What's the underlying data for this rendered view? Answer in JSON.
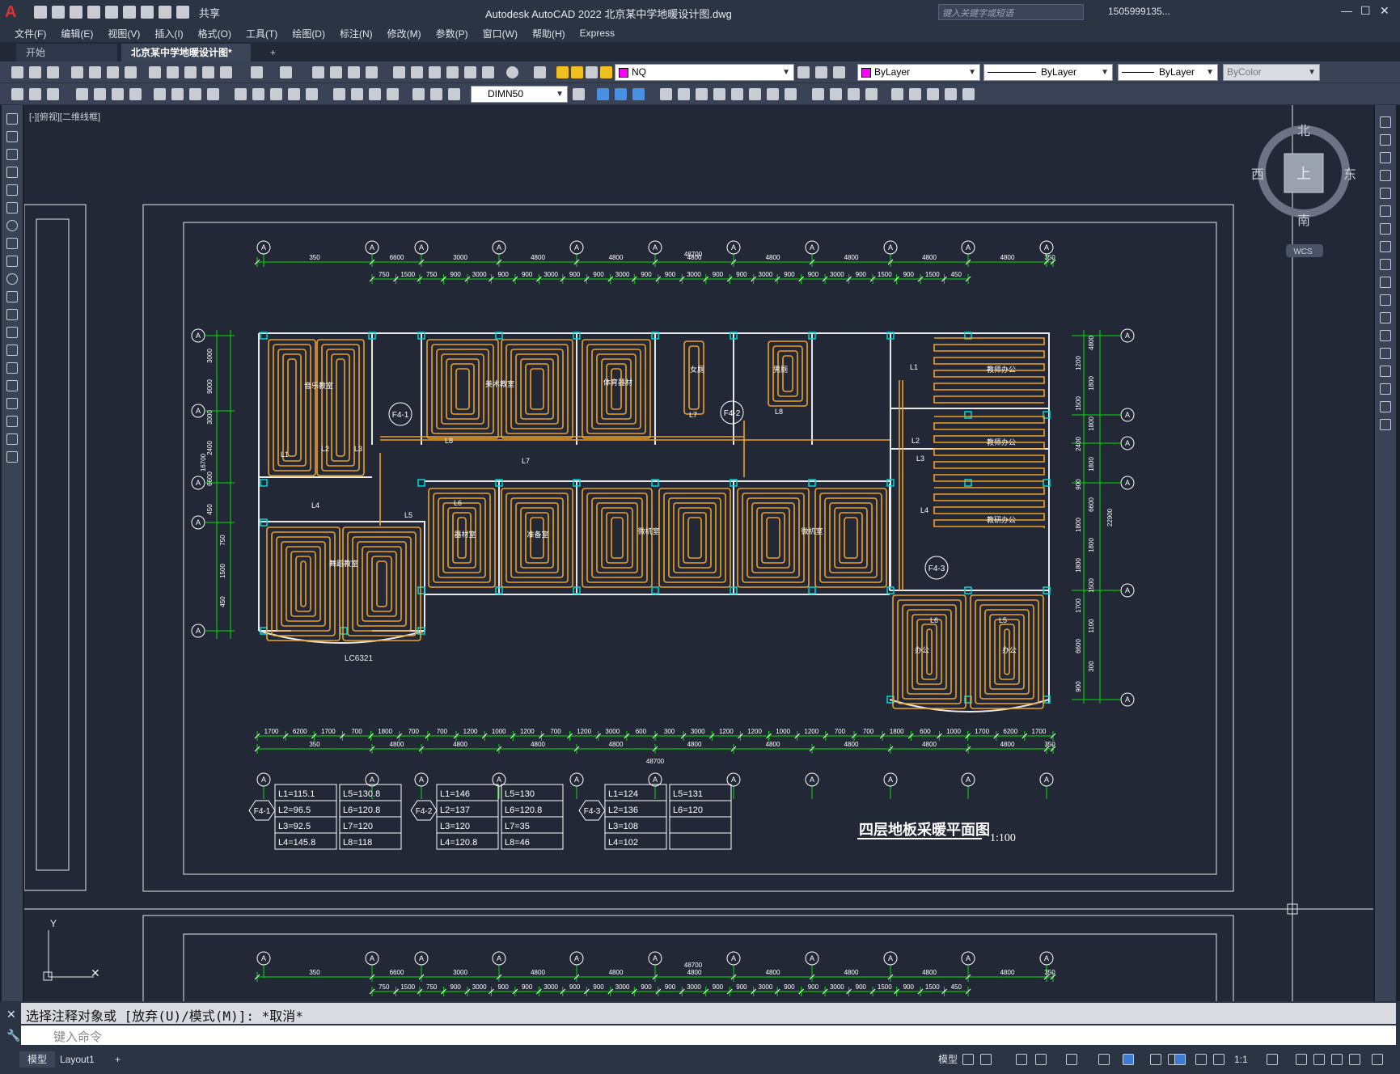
{
  "app": {
    "title": "Autodesk AutoCAD 2022    北京某中学地暖设计图.dwg",
    "share": "共享",
    "search_placeholder": "键入关键字或短语",
    "user": "1505999135...",
    "logo": "A"
  },
  "menu": [
    "文件(F)",
    "编辑(E)",
    "视图(V)",
    "插入(I)",
    "格式(O)",
    "工具(T)",
    "绘图(D)",
    "标注(N)",
    "修改(M)",
    "参数(P)",
    "窗口(W)",
    "帮助(H)",
    "Express"
  ],
  "tabs": {
    "start": "开始",
    "doc": "北京某中学地暖设计图*",
    "close": "×",
    "add": "+"
  },
  "toolbar": {
    "layer": "NQ",
    "color": "ByLayer",
    "linetype": "ByLayer",
    "lineweight": "ByLayer",
    "plotstyle": "ByColor",
    "dimstyle": "DIMN50"
  },
  "viewport": {
    "label": "[-][俯视][二维线框]",
    "north": "北",
    "south": "南",
    "east": "东",
    "west": "西",
    "top": "上",
    "wcs": "WCS"
  },
  "drawing": {
    "title": "四层地板采暖平面图",
    "scale": "1:100",
    "window_label": "LC6321",
    "top_total": "48700",
    "bottom_total": "48700",
    "left_total": "16700",
    "right_total": "22900",
    "top_dims": [
      "6600",
      "3000",
      "4800",
      "4800",
      "4800",
      "4800",
      "4800",
      "4800",
      "4800",
      "350",
      "350"
    ],
    "top_sub": [
      "750",
      "1500",
      "750",
      "900",
      "3000",
      "900",
      "900",
      "3000",
      "900",
      "900",
      "3000",
      "900",
      "900",
      "3000",
      "900",
      "900",
      "3000",
      "900",
      "900",
      "3000",
      "900",
      "1500",
      "900",
      "1500",
      "450"
    ],
    "bottom_dims": [
      "4800",
      "4800",
      "4800",
      "4800",
      "4800",
      "4800",
      "4800",
      "4800",
      "350",
      "350"
    ],
    "bottom_sub": [
      "1700",
      "6200",
      "1700",
      "700",
      "1800",
      "700",
      "700",
      "1200",
      "1000",
      "1200",
      "700",
      "1200",
      "3000",
      "600",
      "300",
      "3000",
      "1200",
      "1200",
      "1000",
      "1200",
      "700",
      "700",
      "1800",
      "600",
      "1000",
      "1700",
      "6200",
      "1700"
    ],
    "left_dims": [
      "3000",
      "9000",
      "3000",
      "2400",
      "6600",
      "450",
      "750",
      "1500",
      "450"
    ],
    "right_dims": [
      "4800",
      "1200",
      "1800",
      "1500",
      "1800",
      "2400",
      "1800",
      "900",
      "6600",
      "1800",
      "1800",
      "1800",
      "1500",
      "1700",
      "1100",
      "6600",
      "300",
      "900"
    ],
    "axis_letter": "A",
    "rooms": [
      "音乐教室",
      "美术教室",
      "体育器材",
      "女厕",
      "男厕",
      "教师办公",
      "教师办公",
      "教研办公",
      "器材室",
      "准备室",
      "微机室",
      "微机室",
      "舞蹈教室",
      "办公",
      "办公"
    ],
    "loops": [
      "L1",
      "L2",
      "L3",
      "L4",
      "L5",
      "L6",
      "L7",
      "L8"
    ],
    "manifolds": [
      "F4-1",
      "F4-2",
      "F4-3"
    ],
    "tables": [
      {
        "id": "F4-1",
        "c1": [
          "L1=115.1",
          "L2=96.5",
          "L3=92.5",
          "L4=145.8"
        ],
        "c2": [
          "L5=130.8",
          "L6=120.8",
          "L7=120",
          "L8=118"
        ]
      },
      {
        "id": "F4-2",
        "c1": [
          "L1=146",
          "L2=137",
          "L3=120",
          "L4=120.8"
        ],
        "c2": [
          "L5=130",
          "L6=120.8",
          "L7=35",
          "L8=46"
        ]
      },
      {
        "id": "F4-3",
        "c1": [
          "L1=124",
          "L2=136",
          "L3=108",
          "L4=102"
        ],
        "c2": [
          "L5=131",
          "L6=120"
        ]
      }
    ]
  },
  "command": {
    "history": "选择注释对象或 [放弃(U)/模式(M)]: *取消*",
    "placeholder": "键入命令"
  },
  "status": {
    "model": "模型",
    "layout1": "Layout1",
    "add": "+",
    "model_btn": "模型",
    "scale": "1:1"
  },
  "colors": {
    "pipe": "#f0a020",
    "wall": "#e8e8e8",
    "dim": "#00e000",
    "column": "#00d8d8",
    "bg": "#222836"
  }
}
